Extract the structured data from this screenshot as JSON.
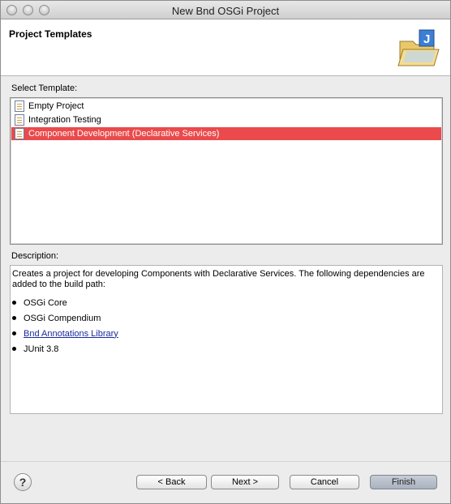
{
  "window": {
    "title": "New Bnd OSGi Project"
  },
  "header": {
    "title": "Project Templates",
    "icon": "folder-java-icon"
  },
  "templates": {
    "label": "Select Template:",
    "items": [
      {
        "label": "Empty Project",
        "icon": "template-icon",
        "selected": false
      },
      {
        "label": "Integration Testing",
        "icon": "template-icon",
        "selected": false
      },
      {
        "label": "Component Development (Declarative Services)",
        "icon": "template-icon",
        "selected": true
      }
    ],
    "selection_color": "#ea4a4c"
  },
  "description": {
    "label": "Description:",
    "text": "Creates a project for developing Components with Declarative Services. The following dependencies are added to the build path:",
    "dependencies": [
      {
        "label": "OSGi Core",
        "link": false
      },
      {
        "label": "OSGi Compendium",
        "link": false
      },
      {
        "label": "Bnd Annotations Library",
        "link": true
      },
      {
        "label": "JUnit 3.8",
        "link": false
      }
    ]
  },
  "footer": {
    "help_label": "?",
    "back_label": "< Back",
    "next_label": "Next >",
    "cancel_label": "Cancel",
    "finish_label": "Finish"
  }
}
